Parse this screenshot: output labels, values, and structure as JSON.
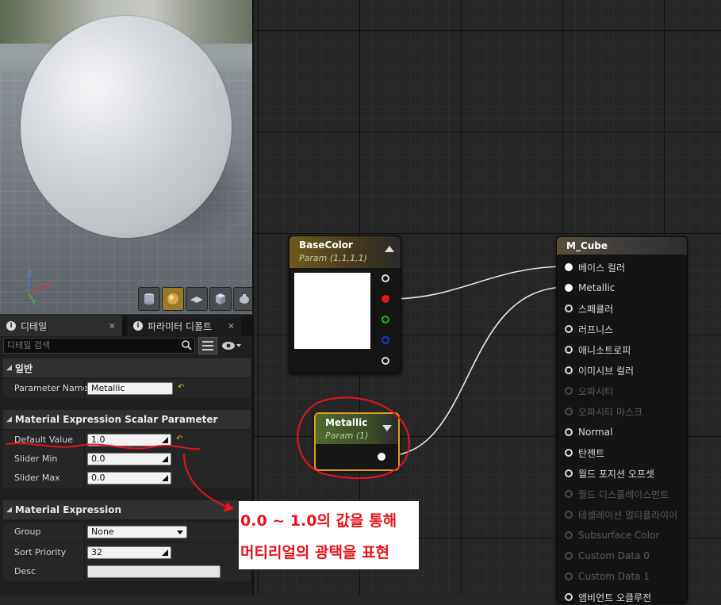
{
  "details": {
    "tabs": [
      {
        "label": "디테일",
        "close": "✕"
      },
      {
        "label": "파라미터 디폴트",
        "close": "✕"
      }
    ],
    "search": {
      "placeholder": "디테일 검색"
    },
    "sections": {
      "general": "일반",
      "scalar": "Material Expression Scalar Parameter",
      "expression": "Material Expression"
    },
    "props": {
      "parameter_name": {
        "label": "Parameter Name",
        "value": "Metallic"
      },
      "default_value": {
        "label": "Default Value",
        "value": "1.0"
      },
      "slider_min": {
        "label": "Slider Min",
        "value": "0.0"
      },
      "slider_max": {
        "label": "Slider Max",
        "value": "0.0"
      },
      "group": {
        "label": "Group",
        "value": "None"
      },
      "sort_priority": {
        "label": "Sort Priority",
        "value": "32"
      },
      "desc": {
        "label": "Desc",
        "value": ""
      }
    }
  },
  "graph": {
    "basecolor_node": {
      "title": "BaseColor",
      "subtitle": "Param (1,1,1,1)",
      "swatch_color": "#ffffff"
    },
    "metallic_node": {
      "title": "Metallic",
      "subtitle": "Param (1)"
    },
    "mcube_node": {
      "title": "M_Cube",
      "inputs": [
        {
          "label": "베이스 컬러",
          "enabled": true,
          "connected": true
        },
        {
          "label": "Metallic",
          "enabled": true,
          "connected": true
        },
        {
          "label": "스페큘러",
          "enabled": true,
          "connected": false
        },
        {
          "label": "러프니스",
          "enabled": true,
          "connected": false
        },
        {
          "label": "애니소트로피",
          "enabled": true,
          "connected": false
        },
        {
          "label": "이미시브 컬러",
          "enabled": true,
          "connected": false
        },
        {
          "label": "오파시티",
          "enabled": false,
          "connected": false
        },
        {
          "label": "오파시티 마스크",
          "enabled": false,
          "connected": false
        },
        {
          "label": "Normal",
          "enabled": true,
          "connected": false
        },
        {
          "label": "탄젠트",
          "enabled": true,
          "connected": false
        },
        {
          "label": "월드 포지션 오프셋",
          "enabled": true,
          "connected": false
        },
        {
          "label": "월드 디스플레이스먼트",
          "enabled": false,
          "connected": false
        },
        {
          "label": "테셀레이션 멀티플라이어",
          "enabled": false,
          "connected": false
        },
        {
          "label": "Subsurface Color",
          "enabled": false,
          "connected": false
        },
        {
          "label": "Custom Data 0",
          "enabled": false,
          "connected": false
        },
        {
          "label": "Custom Data 1",
          "enabled": false,
          "connected": false
        },
        {
          "label": "앰비언트 오클루전",
          "enabled": true,
          "connected": false
        }
      ]
    }
  },
  "annotation": {
    "line1": "0.0 ~ 1.0의 값을 통해",
    "line2": "머티리얼의 광택을 표현",
    "color": "#e8121b"
  },
  "colors": {
    "accent": "#e09d18",
    "wire": "#e6e6e6"
  }
}
